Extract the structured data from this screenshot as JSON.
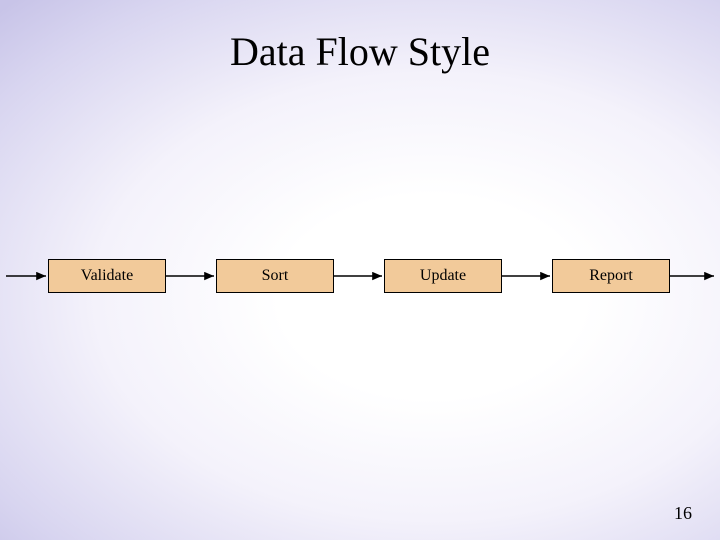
{
  "title": "Data Flow Style",
  "boxes": [
    "Validate",
    "Sort",
    "Update",
    "Report"
  ],
  "page_number": "16"
}
